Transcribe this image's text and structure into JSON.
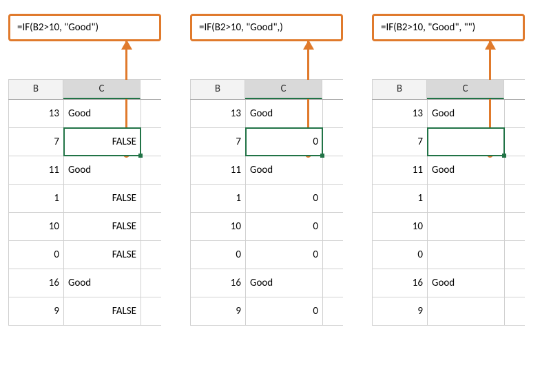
{
  "panels": [
    {
      "formula": "=IF(B2>10, \"Good\")",
      "header_b": "B",
      "header_c": "C",
      "rows": [
        {
          "b": "13",
          "c": "Good",
          "c_align": "txt"
        },
        {
          "b": "7",
          "c": "FALSE",
          "c_align": "num",
          "selected": true
        },
        {
          "b": "11",
          "c": "Good",
          "c_align": "txt"
        },
        {
          "b": "1",
          "c": "FALSE",
          "c_align": "num"
        },
        {
          "b": "10",
          "c": "FALSE",
          "c_align": "num"
        },
        {
          "b": "0",
          "c": "FALSE",
          "c_align": "num"
        },
        {
          "b": "16",
          "c": "Good",
          "c_align": "txt"
        },
        {
          "b": "9",
          "c": "FALSE",
          "c_align": "num"
        }
      ]
    },
    {
      "formula": "=IF(B2>10, \"Good\",)",
      "header_b": "B",
      "header_c": "C",
      "rows": [
        {
          "b": "13",
          "c": "Good",
          "c_align": "txt"
        },
        {
          "b": "7",
          "c": "0",
          "c_align": "num",
          "selected": true
        },
        {
          "b": "11",
          "c": "Good",
          "c_align": "txt"
        },
        {
          "b": "1",
          "c": "0",
          "c_align": "num"
        },
        {
          "b": "10",
          "c": "0",
          "c_align": "num"
        },
        {
          "b": "0",
          "c": "0",
          "c_align": "num"
        },
        {
          "b": "16",
          "c": "Good",
          "c_align": "txt"
        },
        {
          "b": "9",
          "c": "0",
          "c_align": "num"
        }
      ]
    },
    {
      "formula": "=IF(B2>10, \"Good\", \"\")",
      "header_b": "B",
      "header_c": "C",
      "rows": [
        {
          "b": "13",
          "c": "Good",
          "c_align": "txt"
        },
        {
          "b": "7",
          "c": "",
          "c_align": "num",
          "selected": true
        },
        {
          "b": "11",
          "c": "Good",
          "c_align": "txt"
        },
        {
          "b": "1",
          "c": "",
          "c_align": "num"
        },
        {
          "b": "10",
          "c": "",
          "c_align": "num"
        },
        {
          "b": "0",
          "c": "",
          "c_align": "num"
        },
        {
          "b": "16",
          "c": "Good",
          "c_align": "txt"
        },
        {
          "b": "9",
          "c": "",
          "c_align": "num"
        }
      ]
    }
  ]
}
